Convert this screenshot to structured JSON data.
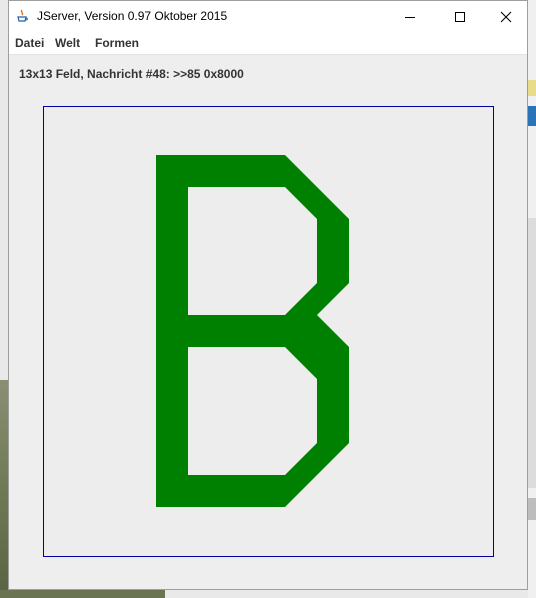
{
  "window": {
    "title": "JServer, Version 0.97 Oktober 2015"
  },
  "menu": {
    "items": [
      "Datei",
      "Welt",
      "Formen"
    ]
  },
  "status": {
    "text": "13x13 Feld, Nachricht #48: >>85 0x8000"
  },
  "board": {
    "grid_size": 13,
    "shape_letter": "B",
    "shape_color": "#008000",
    "frame_color": "#0000a0"
  },
  "icons": {
    "app": "java-icon",
    "minimize": "minimize-icon",
    "maximize": "maximize-icon",
    "close": "close-icon"
  }
}
